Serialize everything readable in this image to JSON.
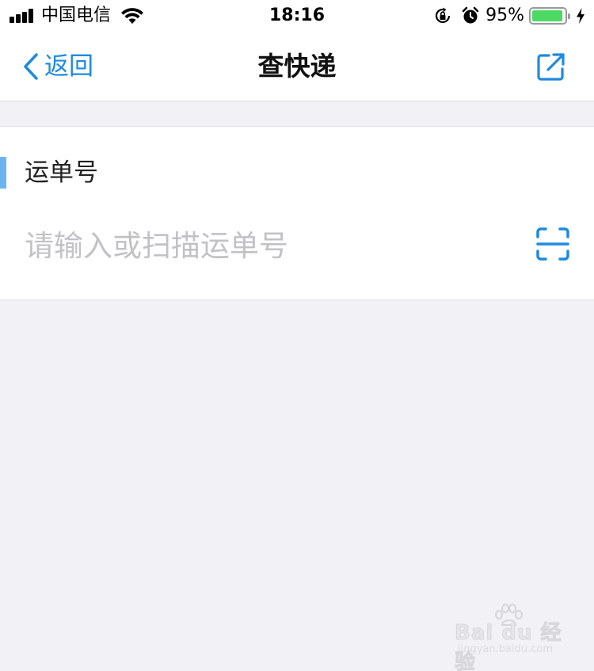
{
  "status_bar": {
    "carrier": "中国电信",
    "time": "18:16",
    "battery_percent": "95%",
    "battery_level": 0.95,
    "icons": [
      "signal-icon",
      "wifi-icon",
      "orientation-lock-icon",
      "alarm-icon",
      "battery-icon",
      "charging-bolt-icon"
    ]
  },
  "nav": {
    "back_label": "返回",
    "title": "查快递",
    "back_icon": "chevron-left-icon",
    "share_icon": "share-external-icon"
  },
  "form": {
    "section_label": "运单号",
    "tracking_input": {
      "value": "",
      "placeholder": "请输入或扫描运单号"
    },
    "scan_icon": "scan-icon"
  },
  "watermark": {
    "logo_text": "Bai du 经验",
    "url": "jingyan.baidu.com"
  },
  "colors": {
    "accent_blue": "#1e8ae0",
    "accent_bar": "#6cb4f0",
    "background": "#f2f2f6",
    "battery_green": "#4cd964"
  }
}
